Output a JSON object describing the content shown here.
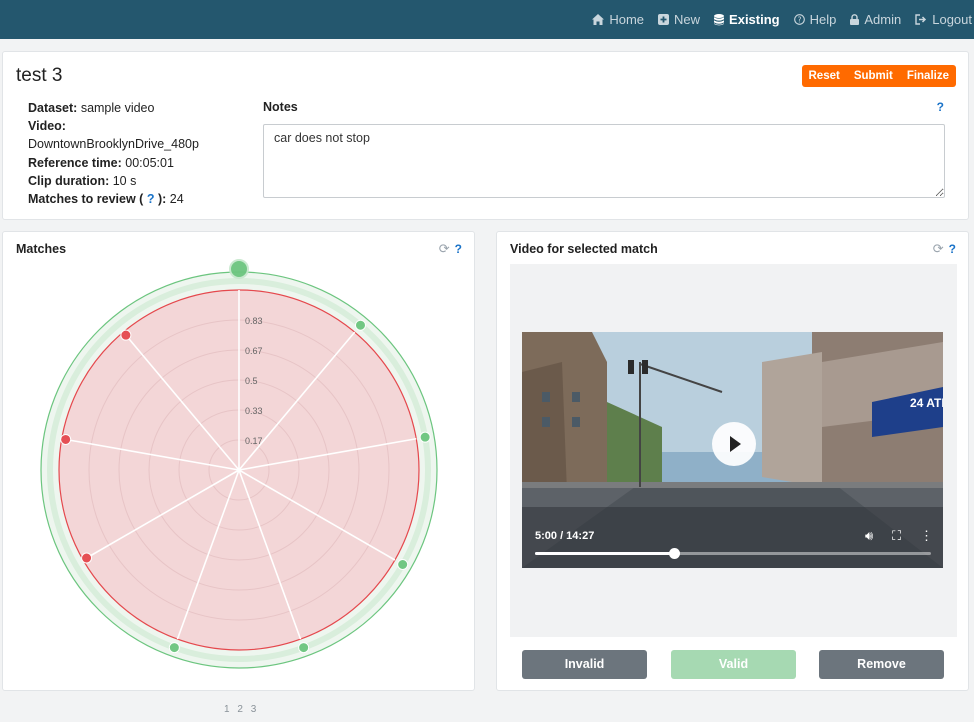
{
  "nav": {
    "items": [
      {
        "label": "Home",
        "icon": "home-icon"
      },
      {
        "label": "New",
        "icon": "plus-square-icon"
      },
      {
        "label": "Existing",
        "icon": "database-icon",
        "active": true
      },
      {
        "label": "Help",
        "icon": "question-circle-icon"
      },
      {
        "label": "Admin",
        "icon": "lock-icon"
      },
      {
        "label": "Logout",
        "icon": "logout-icon"
      }
    ]
  },
  "test": {
    "title": "test 3",
    "buttons": {
      "reset": "Reset",
      "submit": "Submit",
      "finalize": "Finalize"
    },
    "dataset_label": "Dataset:",
    "dataset": "sample video",
    "video_label": "Video:",
    "video": "DowntownBrooklynDrive_480p",
    "reference_label": "Reference time:",
    "reference": "00:05:01",
    "clip_label": "Clip duration:",
    "clip": "10 s",
    "matches_label_a": "Matches to review (",
    "matches_help": "?",
    "matches_label_b": "):",
    "matches": "24"
  },
  "notes": {
    "label": "Notes",
    "help": "?",
    "value": "car does not stop"
  },
  "matches_panel": {
    "title": "Matches",
    "help": "?",
    "radial_ticks": [
      "0.83",
      "0.67",
      "0.5",
      "0.33",
      "0.17"
    ],
    "points": [
      {
        "angle": 0,
        "status": "valid",
        "selected": true
      },
      {
        "angle": 40,
        "status": "valid"
      },
      {
        "angle": 80,
        "status": "valid"
      },
      {
        "angle": 120,
        "status": "valid"
      },
      {
        "angle": 160,
        "status": "valid"
      },
      {
        "angle": 200,
        "status": "valid"
      },
      {
        "angle": 240,
        "status": "invalid"
      },
      {
        "angle": 280,
        "status": "invalid"
      },
      {
        "angle": 320,
        "status": "invalid"
      }
    ],
    "colors": {
      "valid": "#6cc57f",
      "invalid": "#e5484d"
    }
  },
  "video_panel": {
    "title": "Video for selected match",
    "help": "?",
    "time": "5:00 / 14:27",
    "progress": 0.35,
    "buttons": {
      "invalid": "Invalid",
      "valid": "Valid",
      "remove": "Remove"
    }
  },
  "pager": [
    "1",
    "2",
    "3"
  ]
}
